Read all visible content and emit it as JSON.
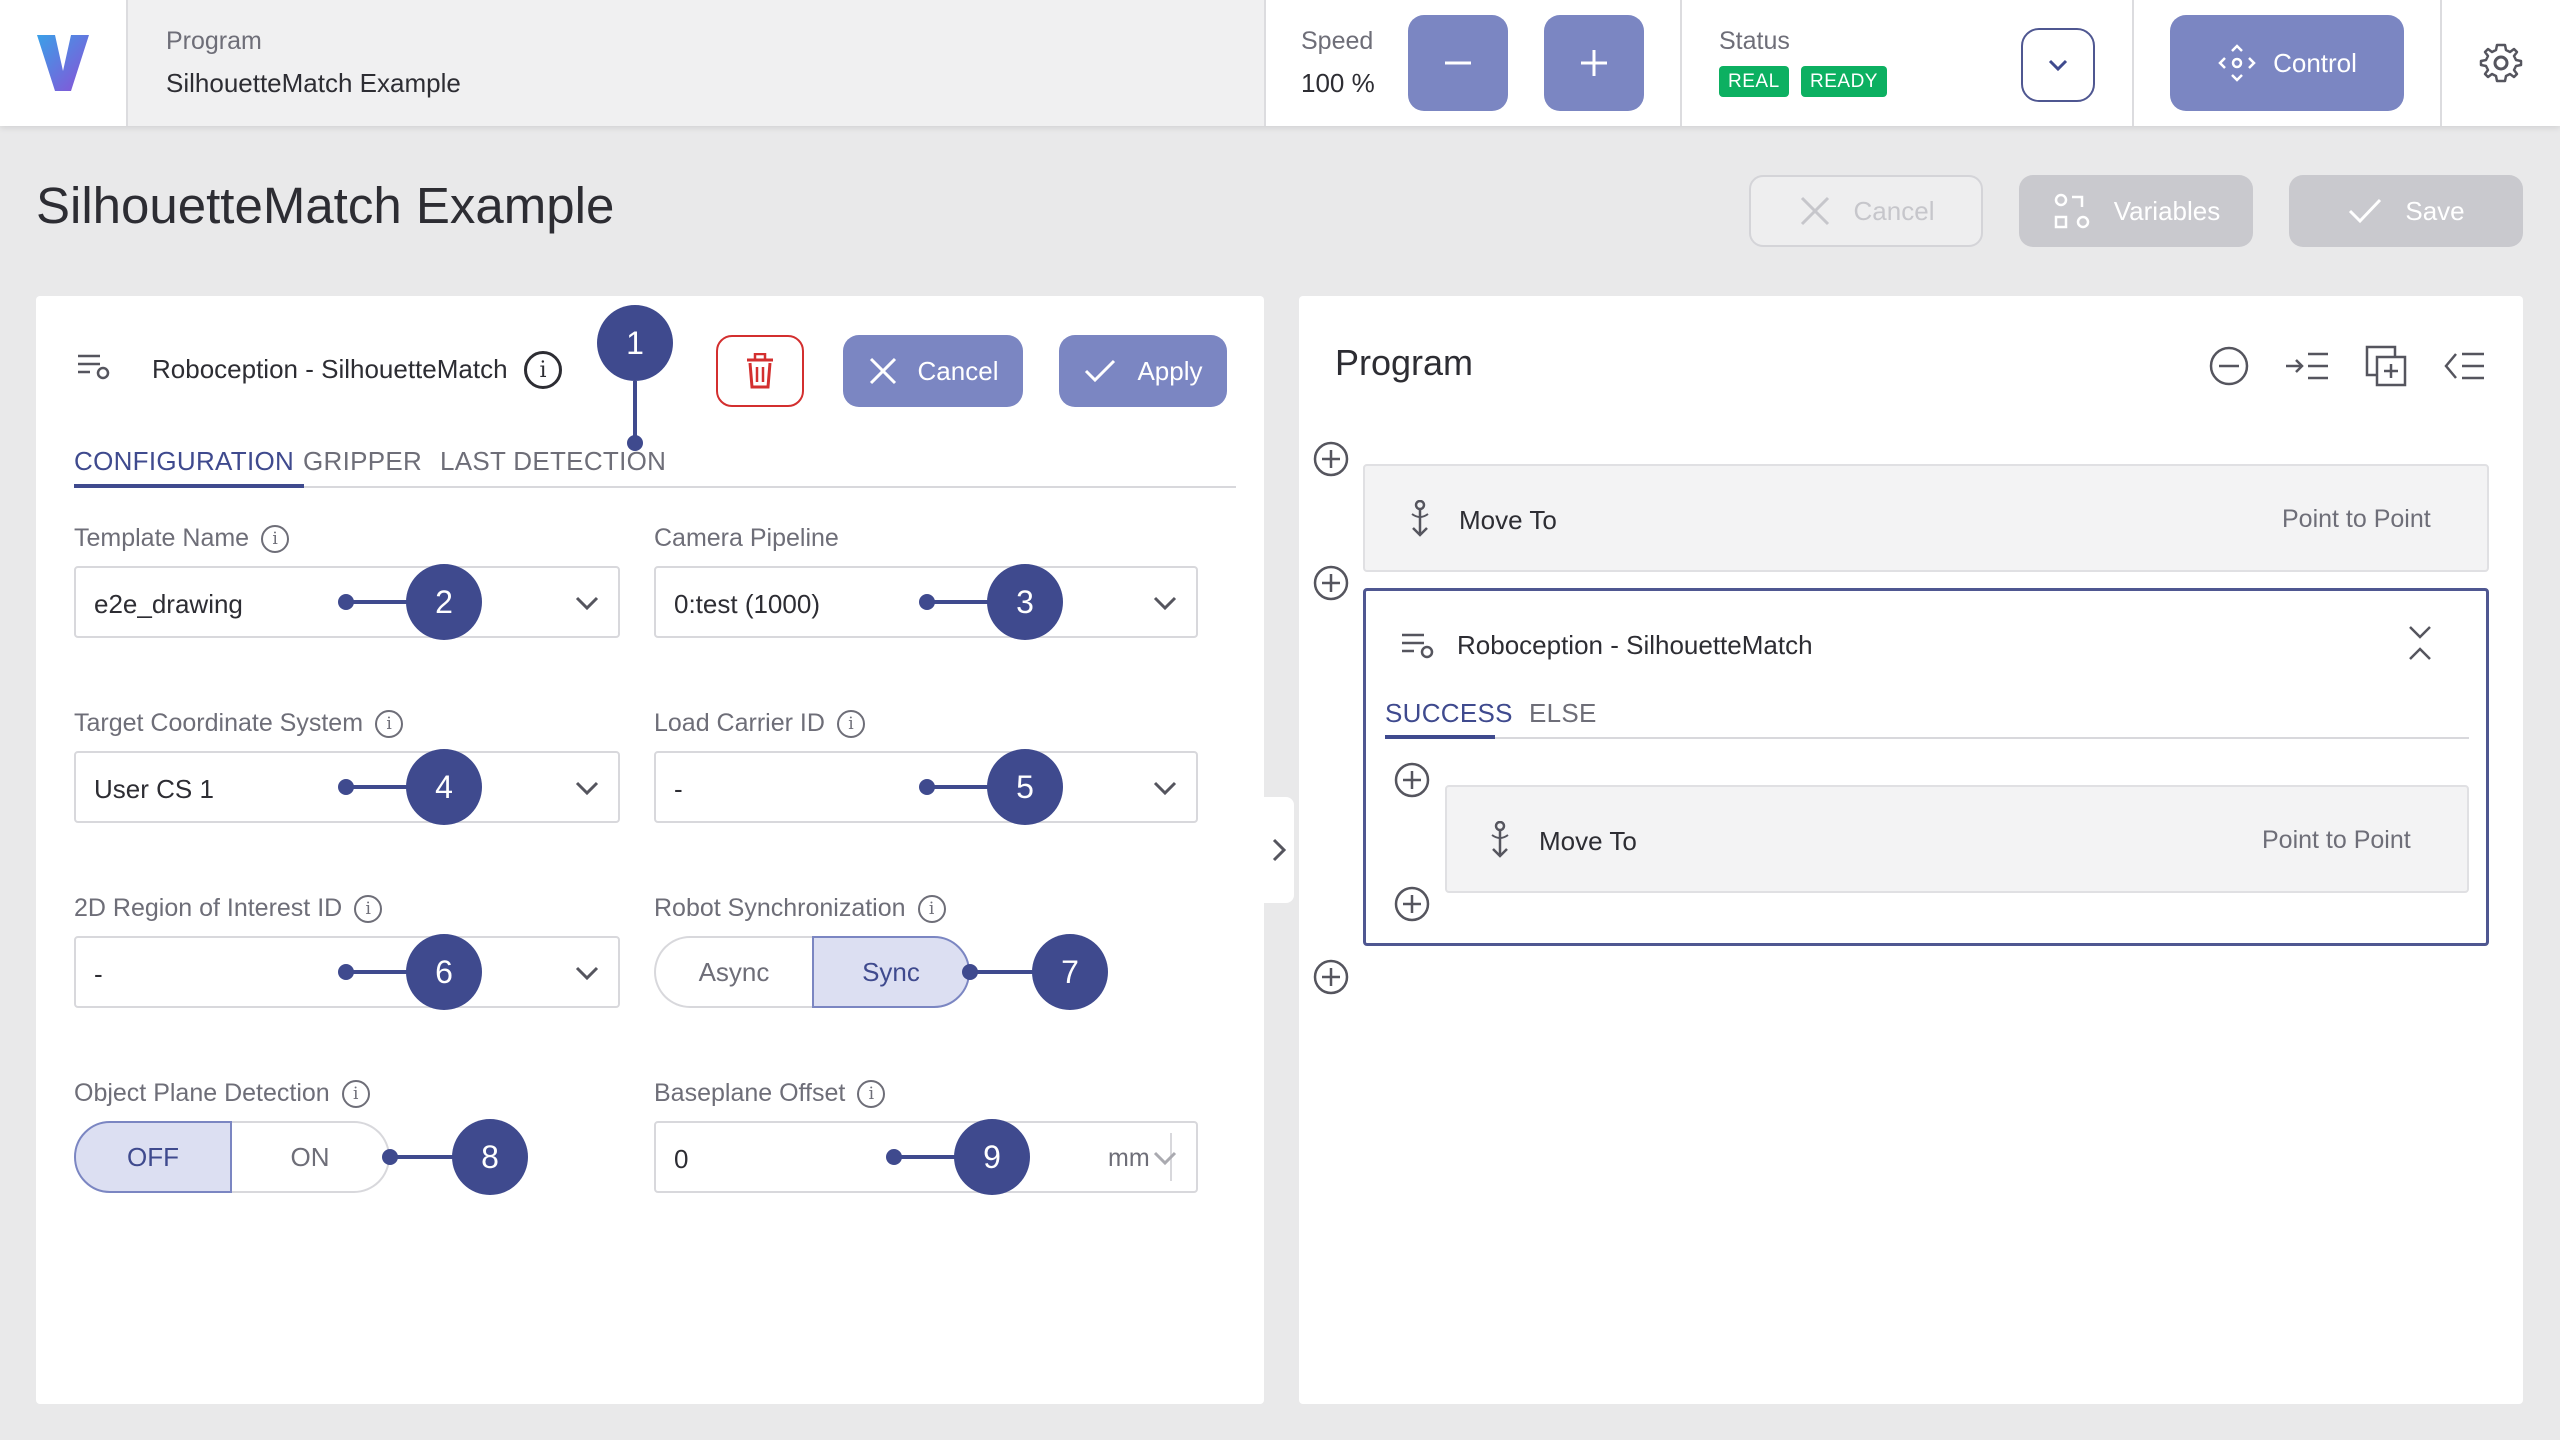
{
  "topbar": {
    "logo": "V",
    "program_label": "Program",
    "program_name": "SilhouetteMatch Example",
    "speed_label": "Speed",
    "speed_value": "100 %",
    "speed_minus_icon": "minus-icon",
    "speed_plus_icon": "plus-icon",
    "status_label": "Status",
    "status_badges": [
      "REAL",
      "READY"
    ],
    "control_label": "Control",
    "settings_icon": "gear-icon"
  },
  "page": {
    "title": "SilhouetteMatch Example",
    "cancel_label": "Cancel",
    "variables_label": "Variables",
    "save_label": "Save"
  },
  "node_editor": {
    "title": "Roboception - SilhouetteMatch",
    "cancel_label": "Cancel",
    "apply_label": "Apply",
    "tabs": [
      "CONFIGURATION",
      "GRIPPER",
      "LAST DETECTION"
    ],
    "active_tab": "CONFIGURATION",
    "fields": {
      "template_name": {
        "label": "Template Name",
        "value": "e2e_drawing"
      },
      "camera_pipeline": {
        "label": "Camera Pipeline",
        "value": "0:test (1000)"
      },
      "target_cs": {
        "label": "Target Coordinate System",
        "value": "User CS 1"
      },
      "load_carrier": {
        "label": "Load Carrier ID",
        "value": "-"
      },
      "roi": {
        "label": "2D Region of Interest ID",
        "value": "-"
      },
      "robot_sync": {
        "label": "Robot Synchronization",
        "options": [
          "Async",
          "Sync"
        ],
        "selected": "Sync"
      },
      "plane_detection": {
        "label": "Object Plane Detection",
        "options": [
          "OFF",
          "ON"
        ],
        "selected": "OFF"
      },
      "baseplane_offset": {
        "label": "Baseplane Offset",
        "value": "0",
        "unit": "mm"
      }
    },
    "callouts": [
      "1",
      "2",
      "3",
      "4",
      "5",
      "6",
      "7",
      "8",
      "9"
    ]
  },
  "program_tree": {
    "title": "Program",
    "toolbar_icons": [
      "collapse-icon",
      "indent-icon",
      "duplicate-icon",
      "comment-icon"
    ],
    "items": [
      {
        "name": "Move To",
        "type": "Point to Point"
      },
      {
        "name": "Roboception - SilhouetteMatch",
        "tabs": [
          "SUCCESS",
          "ELSE"
        ],
        "active_tab": "SUCCESS",
        "children": [
          {
            "name": "Move To",
            "type": "Point to Point"
          }
        ]
      }
    ]
  },
  "colors": {
    "accent": "#3f4a8e",
    "button": "#7b86c2",
    "success": "#0cb061",
    "danger": "#d32f2f"
  }
}
